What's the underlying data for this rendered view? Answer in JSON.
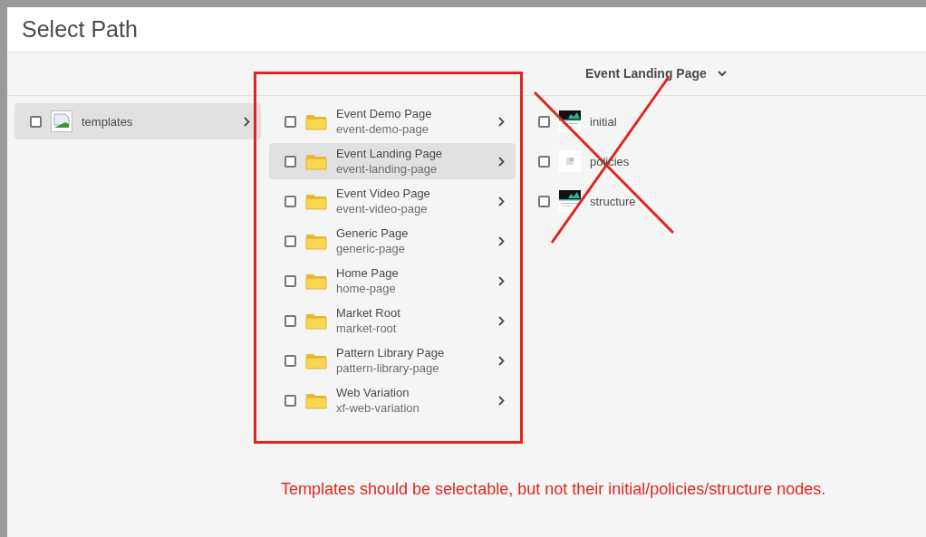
{
  "dialog": {
    "title": "Select Path"
  },
  "breadcrumb": {
    "label": "Event Landing Page"
  },
  "columns": [
    {
      "items": [
        {
          "title": "templates",
          "kind": "image",
          "checked": false,
          "selected": true,
          "has_children": true
        }
      ]
    },
    {
      "items": [
        {
          "title": "Event Demo Page",
          "name": "event-demo-page",
          "kind": "folder",
          "checked": false,
          "selected": false,
          "has_children": true
        },
        {
          "title": "Event Landing Page",
          "name": "event-landing-page",
          "kind": "folder",
          "checked": false,
          "selected": true,
          "has_children": true
        },
        {
          "title": "Event Video Page",
          "name": "event-video-page",
          "kind": "folder",
          "checked": false,
          "selected": false,
          "has_children": true
        },
        {
          "title": "Generic Page",
          "name": "generic-page",
          "kind": "folder",
          "checked": false,
          "selected": false,
          "has_children": true
        },
        {
          "title": "Home Page",
          "name": "home-page",
          "kind": "folder",
          "checked": false,
          "selected": false,
          "has_children": true
        },
        {
          "title": "Market Root",
          "name": "market-root",
          "kind": "folder",
          "checked": false,
          "selected": false,
          "has_children": true
        },
        {
          "title": "Pattern Library Page",
          "name": "pattern-library-page",
          "kind": "folder",
          "checked": false,
          "selected": false,
          "has_children": true
        },
        {
          "title": "Web Variation",
          "name": "xf-web-variation",
          "kind": "folder",
          "checked": false,
          "selected": false,
          "has_children": true
        }
      ]
    },
    {
      "items": [
        {
          "title": "initial",
          "kind": "page",
          "checked": false,
          "selected": false,
          "has_children": false
        },
        {
          "title": "policies",
          "kind": "policy",
          "checked": false,
          "selected": false,
          "has_children": false
        },
        {
          "title": "structure",
          "kind": "page",
          "checked": false,
          "selected": false,
          "has_children": false
        }
      ]
    }
  ],
  "annotation_note": "Templates should be selectable, but not their initial/policies/structure nodes."
}
